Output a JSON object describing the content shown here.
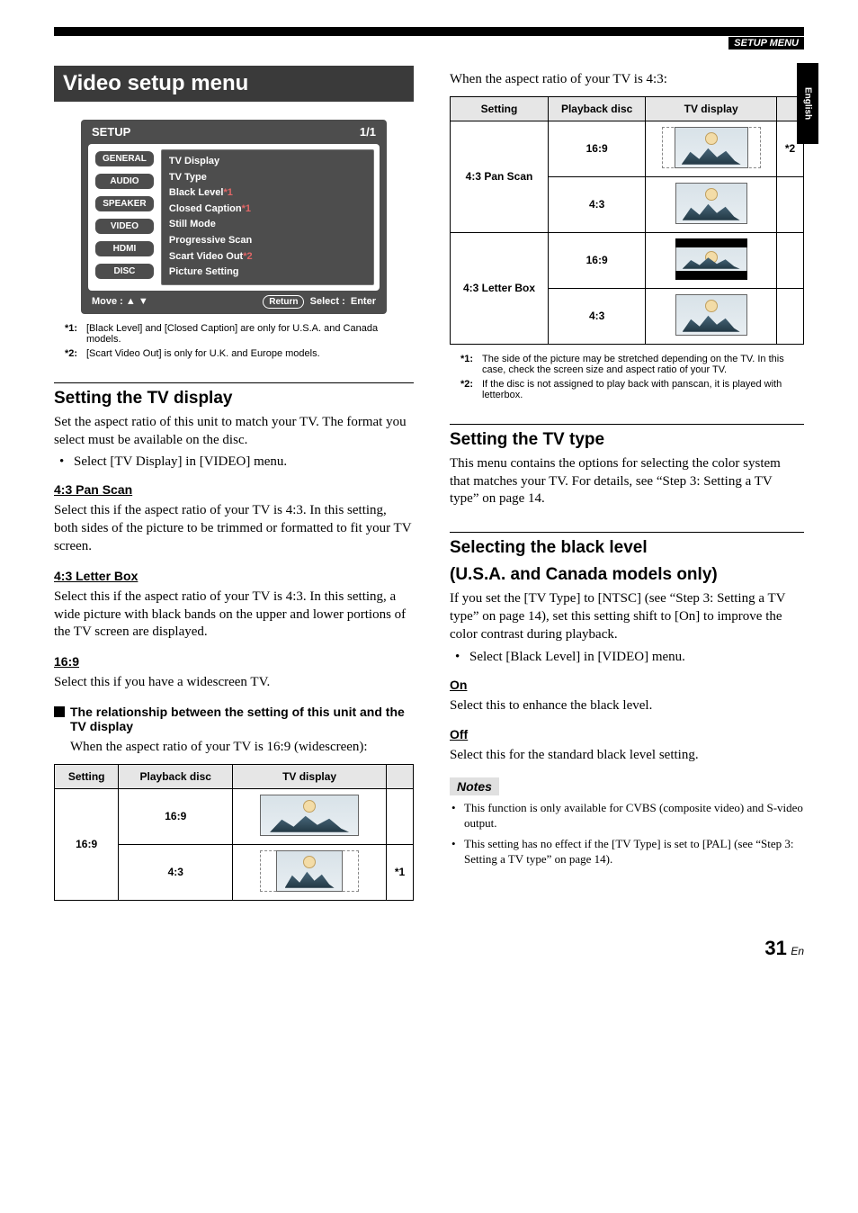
{
  "header": {
    "setup_menu_label": "SETUP MENU",
    "side_tab": "English"
  },
  "chapter_title": "Video setup menu",
  "setup_panel": {
    "title": "SETUP",
    "page": "1/1",
    "tabs": [
      "GENERAL",
      "AUDIO",
      "SPEAKER",
      "VIDEO",
      "HDMI",
      "DISC"
    ],
    "items": [
      "TV Display",
      "TV Type",
      "Black Level",
      "Closed Caption",
      "Still Mode",
      "Progressive Scan",
      "Scart Video Out",
      "Picture Setting"
    ],
    "item_notes": {
      "black_level": "*1",
      "closed_caption": "*1",
      "scart": "*2"
    },
    "footer_move": "Move :",
    "footer_return": "Return",
    "footer_select": "Select :",
    "footer_enter": "Enter"
  },
  "panel_footnotes": {
    "f1_k": "*1:",
    "f1_v": "[Black Level] and [Closed Caption] are only for U.S.A. and Canada models.",
    "f2_k": "*2:",
    "f2_v": "[Scart Video Out] is only for U.K. and Europe models."
  },
  "sec_tv_display": {
    "title": "Setting the TV display",
    "p1": "Set the aspect ratio of this unit to match your TV. The format you select must be available on the disc.",
    "b1": "Select [TV Display] in [VIDEO] menu.",
    "opt1": "4:3 Pan Scan",
    "opt1_p": "Select this if the aspect ratio of your TV is 4:3. In this setting, both sides of the picture to be trimmed or formatted to fit your TV screen.",
    "opt2": "4:3 Letter Box",
    "opt2_p": "Select this if the aspect ratio of your TV is 4:3. In this setting, a wide picture with black bands on the upper and lower portions of the TV screen are displayed.",
    "opt3": "16:9",
    "opt3_p": "Select this if you have a widescreen TV.",
    "sub_h": "The relationship between the setting of this unit and the TV display",
    "sub_p1": "When the aspect ratio of your TV is 16:9 (widescreen):",
    "sub_p2": "When the aspect ratio of your TV is 4:3:"
  },
  "table_headers": {
    "setting": "Setting",
    "disc": "Playback disc",
    "display": "TV display"
  },
  "table1": {
    "setting": "16:9",
    "r1_disc": "16:9",
    "r2_disc": "4:3",
    "r2_note": "*1"
  },
  "table2": {
    "setting1": "4:3 Pan Scan",
    "setting2": "4:3 Letter Box",
    "r1_disc": "16:9",
    "r2_disc": "4:3",
    "r3_disc": "16:9",
    "r4_disc": "4:3",
    "note1": "*2"
  },
  "right_footnotes": {
    "f1_k": "*1:",
    "f1_v": "The side of the picture may be stretched depending on the TV. In this case, check the screen size and aspect ratio of your TV.",
    "f2_k": "*2:",
    "f2_v": "If the disc is not assigned to play back with panscan, it is played with letterbox."
  },
  "sec_tv_type": {
    "title": "Setting the TV type",
    "p": "This menu contains the options for selecting the color system that matches your TV. For details, see “Step 3: Setting a TV type” on page 14."
  },
  "sec_black": {
    "title1": "Selecting the black level",
    "title2": "(U.S.A. and Canada models only)",
    "p": "If you set the [TV Type] to [NTSC] (see “Step 3: Setting a TV type” on page 14), set this setting shift to [On] to improve the color contrast during playback.",
    "b": "Select [Black Level] in [VIDEO] menu.",
    "on": "On",
    "on_p": "Select this to enhance the black level.",
    "off": "Off",
    "off_p": "Select this for the standard black level setting.",
    "notes_label": "Notes",
    "n1": "This function is only available for CVBS (composite video) and S-video output.",
    "n2": "This setting has no effect if the [TV Type] is set to [PAL] (see “Step 3: Setting a TV type” on page 14)."
  },
  "page_number": {
    "n": "31",
    "suffix": "En"
  }
}
